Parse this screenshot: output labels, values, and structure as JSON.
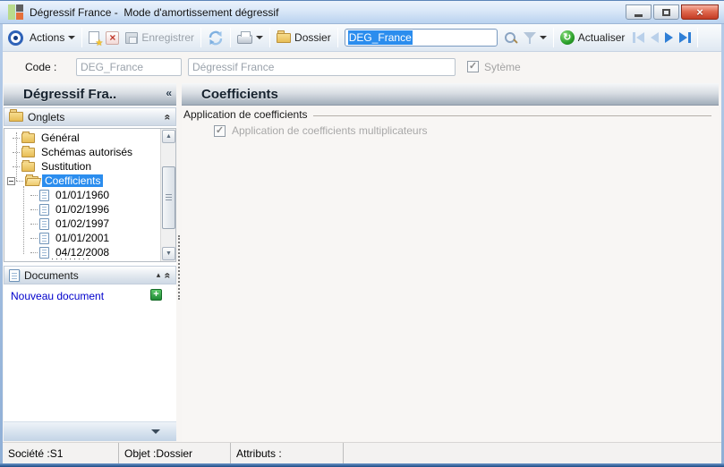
{
  "window": {
    "title": "Dégressif France -  Mode d'amortissement dégressif"
  },
  "glyphs": {
    "close": "×",
    "delete": "×",
    "star": "★",
    "refresh_cw": "↻",
    "check": "✓",
    "plus": "+",
    "chevron": "«",
    "small_up": "▴",
    "scroll_up": "▲",
    "scroll_down": "▼",
    "dots": "·········"
  },
  "toolbar": {
    "actions_label": "Actions",
    "save_label": "Enregistrer",
    "dossier_label": "Dossier",
    "search_value": "DEG_France",
    "actualiser_label": "Actualiser"
  },
  "form": {
    "code_label": "Code :",
    "code_value": "DEG_France",
    "name_value": "Dégressif France",
    "system_label": "Sytème",
    "system_checked": true
  },
  "left_panel": {
    "header": "Dégressif Fra..",
    "onglets": {
      "label": "Onglets",
      "rows": [
        {
          "label": "Général",
          "kind": "folder",
          "level": 0
        },
        {
          "label": "Schémas autorisés",
          "kind": "folder",
          "level": 0
        },
        {
          "label": "Sustitution",
          "kind": "folder",
          "level": 0
        },
        {
          "label": "Coefficients",
          "kind": "folder-open",
          "level": 0,
          "selected": true,
          "expander": true
        },
        {
          "label": "01/01/1960",
          "kind": "doc",
          "level": 1
        },
        {
          "label": "01/02/1996",
          "kind": "doc",
          "level": 1
        },
        {
          "label": "01/02/1997",
          "kind": "doc",
          "level": 1
        },
        {
          "label": "01/01/2001",
          "kind": "doc",
          "level": 1
        },
        {
          "label": "04/12/2008",
          "kind": "doc",
          "level": 1
        }
      ]
    },
    "documents": {
      "label": "Documents",
      "new_document_label": "Nouveau document"
    }
  },
  "main": {
    "header": "Coefficients",
    "group_legend": "Application de coefficients",
    "checkbox_label": "Application de coefficients multiplicateurs",
    "checkbox_checked": true
  },
  "status": {
    "societe": "Société :S1",
    "objet": "Objet :Dossier",
    "attributs": "Attributs :"
  },
  "colors": {
    "selection_blue": "#2b8dee",
    "link_blue": "#0000cc",
    "header_text": "#16222e",
    "disabled_text": "#a3a3a3",
    "plus_green": "#2f9e44",
    "close_red": "#c33b24"
  }
}
